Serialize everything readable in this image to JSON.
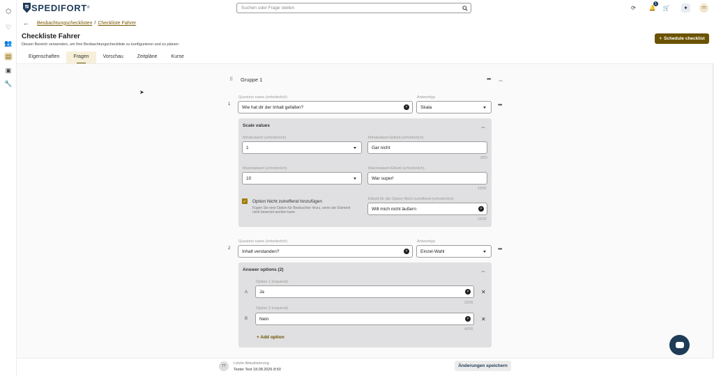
{
  "app": {
    "logo_text": "SPEDIFORT",
    "logo_mark": "®"
  },
  "search": {
    "placeholder": "Suchen oder Frage stellen"
  },
  "topbar": {
    "notification_count": "1",
    "avatar_initials": "TT"
  },
  "breadcrumb": {
    "item1": "Beobachtungschecklisten",
    "separator": "/",
    "item2": "Checkliste Fahrer"
  },
  "page": {
    "title": "Checkliste Fahrer",
    "subtitle": "Diesen Bereich verwenden, um Ihre Beobachtungscheckliste zu konfigurieren und zu planen",
    "schedule_label": "Schedule checklist"
  },
  "tabs": [
    {
      "label": "Eigenschaften"
    },
    {
      "label": "Fragen"
    },
    {
      "label": "Vorschau"
    },
    {
      "label": "Zeitpläne"
    },
    {
      "label": "Kurse"
    }
  ],
  "group": {
    "title": "Gruppe 1"
  },
  "q1": {
    "number": "1",
    "name_label": "Question name (erforderlich)",
    "name_value": "Wie hat dir der Inhalt gefallen?",
    "type_label": "Antworttyp",
    "type_value": "Skala",
    "panel_title": "Scale values",
    "min_label": "Mindestwert (erforderlich)",
    "min_value": "1",
    "min_tag_label": "Mindestwert-Etikett (erforderlich)",
    "min_tag_value": "Gar nicht",
    "min_tag_counter": "9/50",
    "max_label": "Maximalwert (erforderlich)",
    "max_value": "10",
    "max_tag_label": "Maximalwert-Etikett (erforderlich)",
    "max_tag_value": "War super!",
    "max_tag_counter": "10/50",
    "na_checkbox_label": "Option Nicht zutreffend hinzufügen",
    "na_help": "Fügen Sie eine Option für Beobachter hinzu, wenn der Element nicht bewertet werden kann",
    "na_tag_label": "Etikett für die Option Nicht zutreffend (erforderlich)",
    "na_tag_value": "Will mich nicht äußern",
    "na_tag_counter": "22/50"
  },
  "q2": {
    "number": "2",
    "name_label": "Question name (erforderlich)",
    "name_value": "Inhalt verstanden?",
    "type_label": "Antworttyp",
    "type_value": "Einzel-Wahl",
    "panel_title": "Answer options (2)",
    "options": [
      {
        "letter": "A",
        "label": "Option 1 (required)",
        "value": "Ja",
        "counter": "2/255"
      },
      {
        "letter": "B",
        "label": "Option 2 (required)",
        "value": "Nein",
        "counter": "4/255"
      }
    ],
    "add_option": "Add option"
  },
  "footer": {
    "avatar_initials": "TT",
    "last_update_label": "Letzte Aktualisierung",
    "last_update_value": "Tester Test 18.08.2026 8:50",
    "save_label": "Änderungen speichern"
  },
  "colors": {
    "accent": "#6b5200",
    "brand": "#1f3b57",
    "panel": "#e0e0e2"
  }
}
